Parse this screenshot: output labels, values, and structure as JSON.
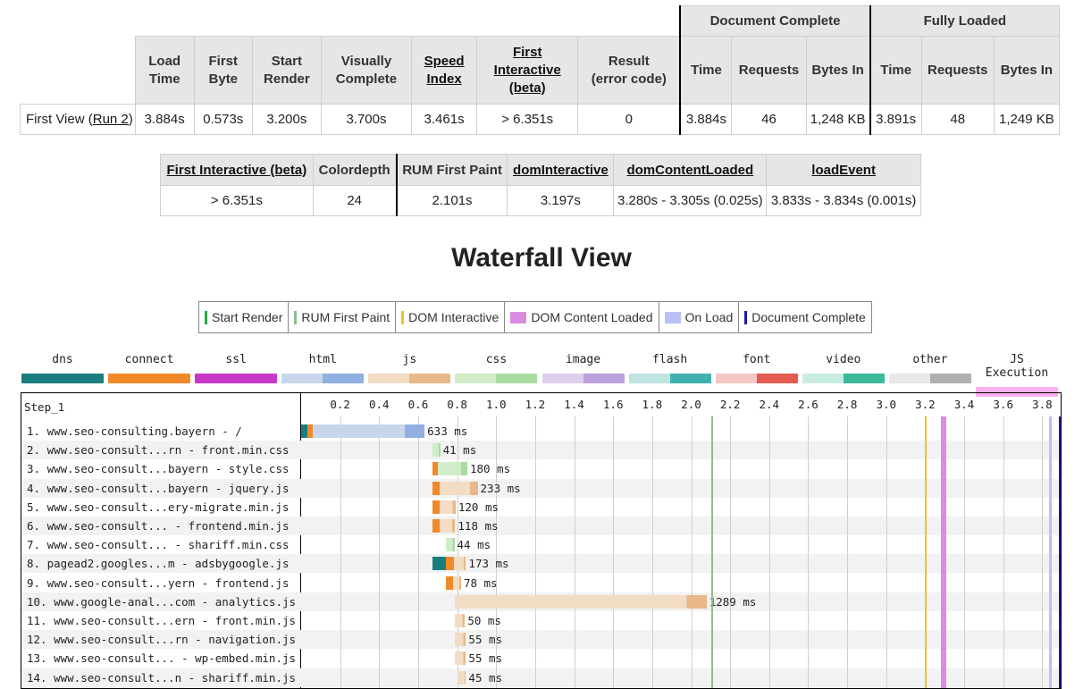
{
  "summary": {
    "group_document_complete": "Document Complete",
    "group_fully_loaded": "Fully Loaded",
    "headers": {
      "load_time": [
        "Load",
        "Time"
      ],
      "first_byte": [
        "First",
        "Byte"
      ],
      "start_render": [
        "Start",
        "Render"
      ],
      "visually_complete": [
        "Visually",
        "Complete"
      ],
      "speed_index": [
        "Speed",
        "Index"
      ],
      "first_interactive": [
        "First",
        "Interactive",
        "(beta)"
      ],
      "result": [
        "Result",
        "(error code)"
      ],
      "time": "Time",
      "requests": "Requests",
      "bytes_in": "Bytes In"
    },
    "row_label_prefix": "First View (",
    "row_label_link": "Run 2",
    "row_label_suffix": ")",
    "values": {
      "load_time": "3.884s",
      "first_byte": "0.573s",
      "start_render": "3.200s",
      "visually_complete": "3.700s",
      "speed_index": "3.461s",
      "first_interactive": "> 6.351s",
      "result": "0",
      "doc_time": "3.884s",
      "doc_requests": "46",
      "doc_bytes": "1,248 KB",
      "full_time": "3.891s",
      "full_requests": "48",
      "full_bytes": "1,249 KB"
    }
  },
  "metrics": {
    "headers": {
      "first_interactive": "First Interactive (beta)",
      "colordepth": "Colordepth",
      "rum_first_paint": "RUM First Paint",
      "dom_interactive": "domInteractive",
      "dom_content_loaded": "domContentLoaded",
      "load_event": "loadEvent"
    },
    "values": {
      "first_interactive": "> 6.351s",
      "colordepth": "24",
      "rum_first_paint": "2.101s",
      "dom_interactive": "3.197s",
      "dom_content_loaded": "3.280s - 3.305s (0.025s)",
      "load_event": "3.833s - 3.834s (0.001s)"
    }
  },
  "waterfall": {
    "title": "Waterfall View",
    "event_legend": [
      {
        "label": "Start Render",
        "color": "#28a745",
        "kind": "line"
      },
      {
        "label": "RUM First Paint",
        "color": "#8fbc8f",
        "kind": "line"
      },
      {
        "label": "DOM Interactive",
        "color": "#f0c030",
        "kind": "line"
      },
      {
        "label": "DOM Content Loaded",
        "color": "#d98ce0",
        "kind": "block"
      },
      {
        "label": "On Load",
        "color": "#b9c0f5",
        "kind": "block"
      },
      {
        "label": "Document Complete",
        "color": "#1a1aa8",
        "kind": "line"
      }
    ],
    "type_legend": [
      {
        "label": "dns",
        "c1": "#1b7e7e",
        "c2": "#1b7e7e"
      },
      {
        "label": "connect",
        "c1": "#f08a28",
        "c2": "#f08a28"
      },
      {
        "label": "ssl",
        "c1": "#c838c8",
        "c2": "#c838c8"
      },
      {
        "label": "html",
        "c1": "#c8d6ec",
        "c2": "#8fb0e0"
      },
      {
        "label": "js",
        "c1": "#f2dcc4",
        "c2": "#e8b888"
      },
      {
        "label": "css",
        "c1": "#d0ecc8",
        "c2": "#a8dca0"
      },
      {
        "label": "image",
        "c1": "#ddd0ec",
        "c2": "#bba0dc"
      },
      {
        "label": "flash",
        "c1": "#bfe4e0",
        "c2": "#40b0b0"
      },
      {
        "label": "font",
        "c1": "#f4c8c4",
        "c2": "#e45c50"
      },
      {
        "label": "video",
        "c1": "#c8ece0",
        "c2": "#3cb89a"
      },
      {
        "label": "other",
        "c1": "#e8e8e8",
        "c2": "#b0b0b0"
      },
      {
        "label": "JS Execution",
        "c1": "#ffb0f0",
        "c2": "#ffb0f0"
      }
    ],
    "step_label": "Step_1",
    "scale_max": 3.89,
    "ticks": [
      "0.2",
      "0.4",
      "0.6",
      "0.8",
      "1.0",
      "1.2",
      "1.4",
      "1.6",
      "1.8",
      "2.0",
      "2.2",
      "2.4",
      "2.6",
      "2.8",
      "3.0",
      "3.2",
      "3.4",
      "3.6",
      "3.8"
    ],
    "events": {
      "rum_first_paint": 2.101,
      "dom_interactive": 3.197,
      "dom_content_loaded": [
        3.28,
        3.305
      ],
      "on_load": [
        3.833,
        3.834
      ],
      "document_complete": 3.884
    },
    "requests": [
      {
        "label": "1. www.seo-consulting.bayern - /",
        "type": "html",
        "start": 0.0,
        "pre": [
          [
            "dns",
            0.0,
            0.03
          ],
          [
            "connect",
            0.03,
            0.06
          ]
        ],
        "end": 0.633,
        "time": "633 ms"
      },
      {
        "label": "2. www.seo-consult...rn - front.min.css",
        "type": "css",
        "start": 0.672,
        "pre": [],
        "end": 0.713,
        "time": "41 ms"
      },
      {
        "label": "3. www.seo-consult...bayern - style.css",
        "type": "css",
        "start": 0.672,
        "pre": [
          [
            "connect",
            0.672,
            0.702
          ]
        ],
        "end": 0.852,
        "time": "180 ms"
      },
      {
        "label": "4. www.seo-consult...bayern - jquery.js",
        "type": "js",
        "start": 0.672,
        "pre": [
          [
            "connect",
            0.672,
            0.71
          ]
        ],
        "end": 0.905,
        "time": "233 ms"
      },
      {
        "label": "5. www.seo-consult...ery-migrate.min.js",
        "type": "js",
        "start": 0.672,
        "pre": [
          [
            "connect",
            0.672,
            0.71
          ]
        ],
        "end": 0.792,
        "time": "120 ms"
      },
      {
        "label": "6. www.seo-consult... - frontend.min.js",
        "type": "js",
        "start": 0.672,
        "pre": [
          [
            "connect",
            0.672,
            0.71
          ]
        ],
        "end": 0.79,
        "time": "118 ms"
      },
      {
        "label": "7. www.seo-consult... - shariff.min.css",
        "type": "css",
        "start": 0.742,
        "pre": [],
        "end": 0.786,
        "time": "44 ms"
      },
      {
        "label": "8. pagead2.googles...m - adsbygoogle.js",
        "type": "js",
        "start": 0.672,
        "pre": [
          [
            "dns",
            0.672,
            0.742
          ],
          [
            "connect",
            0.742,
            0.782
          ]
        ],
        "end": 0.845,
        "time": "173 ms"
      },
      {
        "label": "9. www.seo-consult...yern - frontend.js",
        "type": "js",
        "start": 0.742,
        "pre": [
          [
            "connect",
            0.742,
            0.78
          ]
        ],
        "end": 0.82,
        "time": "78 ms"
      },
      {
        "label": "10. www.google-anal...com - analytics.js",
        "type": "js",
        "start": 0.79,
        "pre": [],
        "end": 2.079,
        "time": "1289 ms"
      },
      {
        "label": "11. www.seo-consult...ern - front.min.js",
        "type": "js",
        "start": 0.79,
        "pre": [],
        "end": 0.84,
        "time": "50 ms"
      },
      {
        "label": "12. www.seo-consult...rn - navigation.js",
        "type": "js",
        "start": 0.79,
        "pre": [],
        "end": 0.845,
        "time": "55 ms"
      },
      {
        "label": "13. www.seo-consult... - wp-embed.min.js",
        "type": "js",
        "start": 0.79,
        "pre": [],
        "end": 0.845,
        "time": "55 ms"
      },
      {
        "label": "14. www.seo-consult...n - shariff.min.js",
        "type": "js",
        "start": 0.8,
        "pre": [],
        "end": 0.845,
        "time": "45 ms"
      }
    ]
  }
}
